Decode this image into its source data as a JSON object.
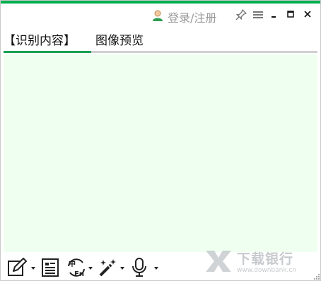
{
  "header": {
    "login_label": "登录/注册"
  },
  "tabs": [
    {
      "label": "【识别内容】",
      "active": true
    },
    {
      "label": "图像预览",
      "active": false
    }
  ],
  "toolbar_icons": [
    "edit-icon",
    "document-icon",
    "translate-icon",
    "magic-wand-icon",
    "microphone-icon"
  ],
  "watermark": {
    "name": "下载银行",
    "url": "www.downbank.cn"
  },
  "colors": {
    "accent": "#00b050",
    "content_bg": "#effff0",
    "active_tab_line": "#1aa055"
  }
}
